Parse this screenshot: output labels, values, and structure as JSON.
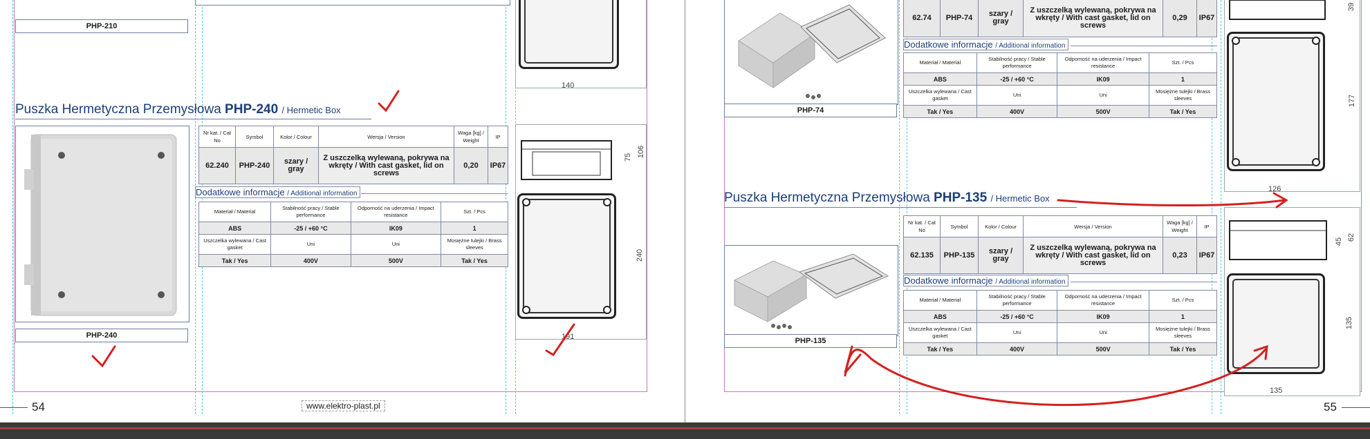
{
  "left_page": {
    "page_number": "54",
    "footer_url": "www.elektro-plast.pl",
    "prev_caption": "PHP-210",
    "prev_dim_bottom": "140",
    "product": {
      "heading_main": "Puszka Hermetyczna Przemysłowa",
      "heading_model": "PHP-240",
      "heading_sub": "/ Hermetic Box",
      "caption": "PHP-240",
      "table_headers": [
        "Nr kat. / Cat No",
        "Symbol",
        "Kolor / Colour",
        "Wersja / Version",
        "Waga [kg] / Weight",
        "IP"
      ],
      "table_values": [
        "62.240",
        "PHP-240",
        "szary / gray",
        "Z uszczelką wylewaną, pokrywa na wkręty / With cast gasket, lid on screws",
        "0,20",
        "IP67"
      ],
      "additional_title": "Dodatkowe informacje",
      "additional_title_en": "/ Additional information",
      "add_headers_1": [
        "Materiał / Material",
        "Stabilność pracy / Stable performance",
        "Odporność na uderzenia / Impact resistance",
        "Szt. / Pcs"
      ],
      "add_values_1": [
        "ABS",
        "-25 / +60 °C",
        "IK09",
        "1"
      ],
      "add_headers_2": [
        "Uszczelka wylewana / Cast gasket",
        "Uni",
        "Uni",
        "Mosiężne tulejki / Brass sleeves"
      ],
      "add_values_2": [
        "Tak / Yes",
        "400V",
        "500V",
        "Tak / Yes"
      ],
      "dim_side_h": "75",
      "dim_side_total": "106",
      "dim_front_h": "240",
      "dim_front_w": "191"
    }
  },
  "right_page": {
    "page_number": "55",
    "top_product": {
      "caption": "PHP-74",
      "table_values": [
        "62.74",
        "PHP-74",
        "szary / gray",
        "Z uszczelką wylewaną, pokrywa na wkręty / With cast gasket, lid on screws",
        "0,29",
        "IP67"
      ],
      "additional_title": "Dodatkowe informacje",
      "additional_title_en": "/ Additional information",
      "add_headers_1": [
        "Materiał / Material",
        "Stabilność pracy / Stable performance",
        "Odporność na uderzenia / Impact resistance",
        "Szt. / Pcs"
      ],
      "add_values_1": [
        "ABS",
        "-25 / +60 °C",
        "IK09",
        "1"
      ],
      "add_headers_2": [
        "Uszczelka wylewana / Cast gasket",
        "Uni",
        "Uni",
        "Mosiężne tulejki / Brass sleeves"
      ],
      "add_values_2": [
        "Tak / Yes",
        "400V",
        "500V",
        "Tak / Yes"
      ],
      "dim_top": "39",
      "dim_side": "177",
      "dim_bottom": "126"
    },
    "product": {
      "heading_main": "Puszka Hermetyczna Przemysłowa",
      "heading_model": "PHP-135",
      "heading_sub": "/ Hermetic Box",
      "caption": "PHP-135",
      "table_headers": [
        "Nr kat. / Cat No",
        "Symbol",
        "Kolor / Colour",
        "Wersja / Version",
        "Waga [kg] / Weight",
        "IP"
      ],
      "table_values": [
        "62.135",
        "PHP-135",
        "szary / gray",
        "Z uszczelką wylewaną, pokrywa na wkręty / With cast gasket, lid on screws",
        "0,23",
        "IP67"
      ],
      "additional_title": "Dodatkowe informacje",
      "additional_title_en": "/ Additional information",
      "add_headers_1": [
        "Materiał / Material",
        "Stabilność pracy / Stable performance",
        "Odporność na uderzenia / Impact resistance",
        "Szt. / Pcs"
      ],
      "add_values_1": [
        "ABS",
        "-25 / +60 °C",
        "IK09",
        "1"
      ],
      "add_headers_2": [
        "Uszczelka wylewana / Cast gasket",
        "Uni",
        "Uni",
        "Mosiężne tulejki / Brass sleeves"
      ],
      "add_values_2": [
        "Tak / Yes",
        "400V",
        "500V",
        "Tak / Yes"
      ],
      "dim_side_h": "45",
      "dim_side_total": "62",
      "dim_front_h": "135",
      "dim_front_w": "135"
    }
  },
  "colors": {
    "heading": "#1d3f78",
    "annotation": "#d42020",
    "guide": "#54c8e0",
    "margin": "#c05aa8"
  }
}
